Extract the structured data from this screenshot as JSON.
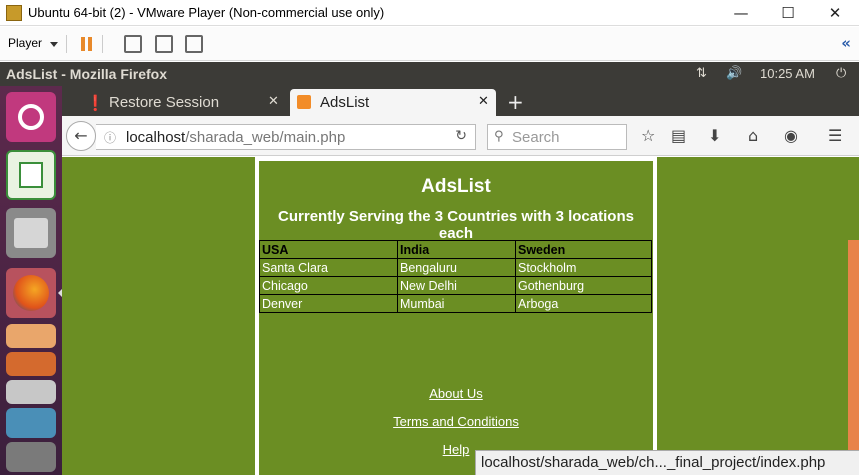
{
  "vmware": {
    "window_title": "Ubuntu 64-bit (2) - VMware Player (Non-commercial use only)",
    "menu_label": "Player",
    "colors": {
      "pause": "#e8892a",
      "collapse": "#2a5caa"
    }
  },
  "ubuntu": {
    "app_title": "AdsList - Mozilla Firefox",
    "clock": "10:25 AM",
    "indicators": [
      "network-icon",
      "volume-icon",
      "power-icon"
    ],
    "launcher": [
      "ubuntu-logo-icon",
      "libreoffice-calc-icon",
      "files-icon",
      "firefox-icon",
      "impress-icon",
      "software-center-icon",
      "layers-icon",
      "trash-icon"
    ],
    "colors": {
      "panel": "#3c3b37",
      "launcher": "#5d2a4d"
    }
  },
  "firefox": {
    "tabs": [
      {
        "label": "Restore Session",
        "icon": "warning-icon",
        "active": false
      },
      {
        "label": "AdsList",
        "icon": "xampp-icon",
        "active": true
      }
    ],
    "url": {
      "host": "localhost",
      "path": "/sharada_web/main.php"
    },
    "search_placeholder": "Search",
    "status_url": "localhost/sharada_web/ch..._final_project/index.php"
  },
  "page": {
    "title": "AdsList",
    "subtitle": "Currently Serving the 3 Countries with 3 locations each",
    "table": {
      "headers": [
        "USA",
        "India",
        "Sweden"
      ],
      "rows": [
        [
          "Santa Clara",
          "Bengaluru",
          "Stockholm"
        ],
        [
          "Chicago",
          "New Delhi",
          "Gothenburg"
        ],
        [
          "Denver",
          "Mumbai",
          "Arboga"
        ]
      ]
    },
    "links": [
      "About Us",
      "Terms and Conditions",
      "Help"
    ],
    "colors": {
      "background": "#6b8e23",
      "text": "#ffffff"
    }
  }
}
